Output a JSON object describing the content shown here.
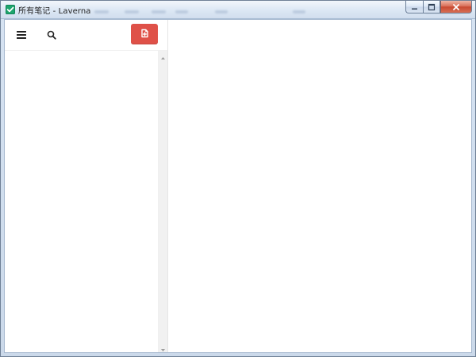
{
  "window": {
    "title": "所有笔记 - Laverna"
  },
  "icons": {
    "app": "laverna-check-icon",
    "menu": "hamburger-menu-icon",
    "search": "search-icon",
    "new_note": "new-note-icon",
    "minimize": "minimize-icon",
    "maximize": "maximize-icon",
    "close": "close-icon",
    "scroll_up": "scroll-up-icon",
    "scroll_down": "scroll-down-icon"
  },
  "colors": {
    "new_note_button": "#df5148",
    "app_icon": "#1ea56d"
  }
}
